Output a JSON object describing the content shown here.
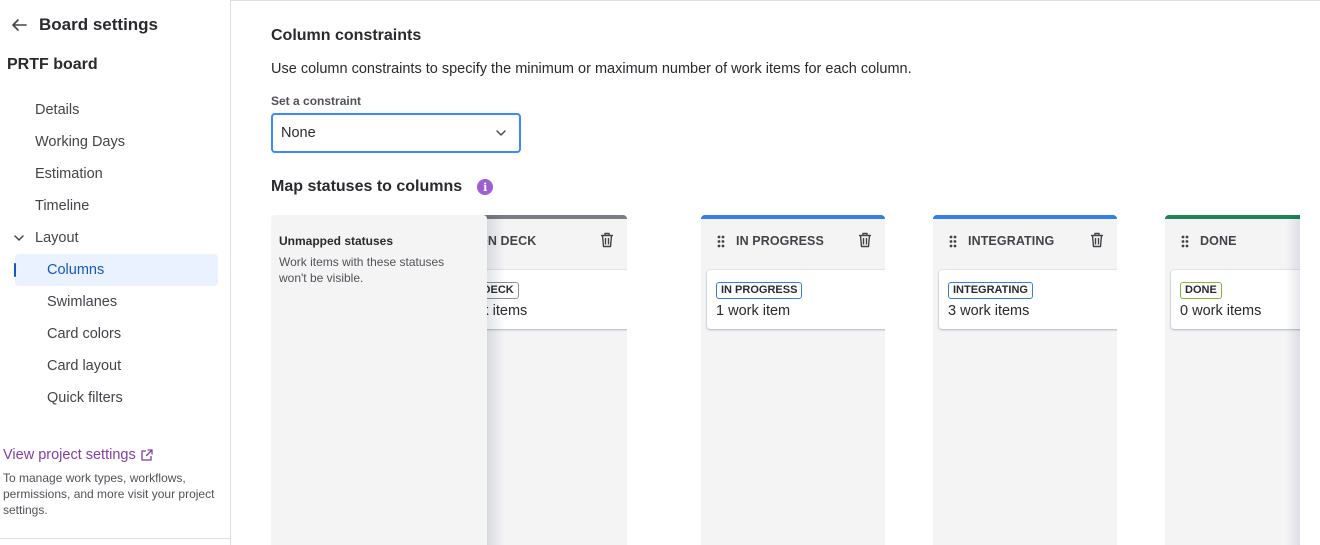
{
  "sidebar": {
    "header_title": "Board settings",
    "board_name": "PRTF board",
    "items": [
      {
        "label": "Details"
      },
      {
        "label": "Working Days"
      },
      {
        "label": "Estimation"
      },
      {
        "label": "Timeline"
      }
    ],
    "group": {
      "label": "Layout",
      "expanded": true,
      "children": [
        {
          "label": "Columns",
          "active": true
        },
        {
          "label": "Swimlanes"
        },
        {
          "label": "Card colors"
        },
        {
          "label": "Card layout"
        },
        {
          "label": "Quick filters"
        }
      ]
    },
    "project_link": "View project settings",
    "project_desc": "To manage work types, workflows, permissions, and more visit your project settings."
  },
  "main": {
    "constraints_title": "Column constraints",
    "constraints_desc": "Use column constraints to specify the minimum or maximum number of work items for each column.",
    "constraint_label": "Set a constraint",
    "constraint_value": "None",
    "map_title": "Map statuses to columns",
    "info_icon": "i"
  },
  "board": {
    "unmapped": {
      "title": "Unmapped statuses",
      "desc": "Work items with these statuses won't be visible."
    },
    "columns": [
      {
        "name": "ON DECK",
        "status": "ON DECK",
        "count": "work items",
        "bar_color": "#7a7d84",
        "lozenge_color": "#8c8f97"
      },
      {
        "name": "IN PROGRESS",
        "status": "IN PROGRESS",
        "count": "1 work item",
        "bar_color": "#357de8",
        "lozenge_color": "#357de8"
      },
      {
        "name": "INTEGRATING",
        "status": "INTEGRATING",
        "count": "3 work items",
        "bar_color": "#357de8",
        "lozenge_color": "#357de8"
      },
      {
        "name": "DONE",
        "status": "DONE",
        "count": "0 work items",
        "bar_color": "#1f845a",
        "lozenge_color": "#82b536"
      }
    ]
  }
}
